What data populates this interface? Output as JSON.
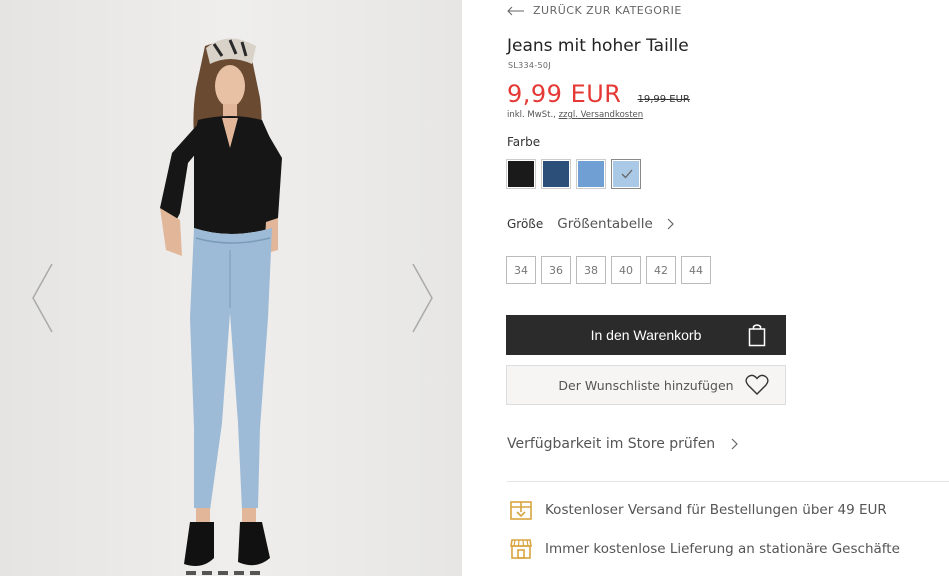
{
  "gallery": {
    "prev_icon": "chevron-left-icon",
    "next_icon": "chevron-right-icon"
  },
  "nav": {
    "back_label": "ZURÜCK ZUR KATEGORIE"
  },
  "product": {
    "title": "Jeans mit hoher Taille",
    "sku": "SL334-50J",
    "price": "9,99 EUR",
    "old_price": "19,99 EUR",
    "vat_text": "inkl. MwSt., ",
    "shipping_link": "zzgl. Versandkosten",
    "price_color": "#e53935"
  },
  "colors": {
    "label": "Farbe",
    "swatches": [
      {
        "name": "black",
        "hex": "#1a1a1a"
      },
      {
        "name": "dark-blue",
        "hex": "#2c4f7a"
      },
      {
        "name": "mid-blue",
        "hex": "#6f9fd3"
      },
      {
        "name": "light-blue",
        "hex": "#a9c9e6",
        "selected": true
      }
    ]
  },
  "sizes": {
    "label": "Größe",
    "table_link": "Größentabelle",
    "options": [
      "34",
      "36",
      "38",
      "40",
      "42",
      "44"
    ]
  },
  "actions": {
    "cart_label": "In den Warenkorb",
    "wishlist_label": "Der Wunschliste hinzufügen",
    "store_label": "Verfügbarkeit im Store prüfen"
  },
  "perks": [
    {
      "icon": "shipping-box-icon",
      "text": "Kostenloser Versand für Bestellungen über 49 EUR"
    },
    {
      "icon": "store-icon",
      "text": "Immer kostenlose Lieferung an stationäre Geschäfte"
    }
  ],
  "accent_color": "#d9a441"
}
